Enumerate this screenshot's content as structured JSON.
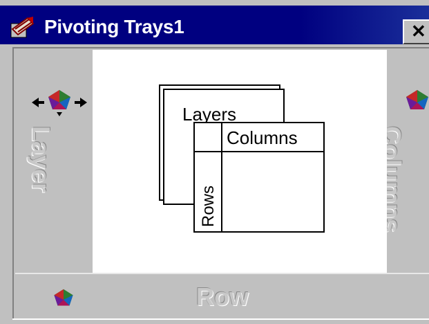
{
  "window": {
    "title": "Pivoting Trays1",
    "close_label": "✕"
  },
  "trays": {
    "layer_label": "Layer",
    "column_label": "Columns",
    "row_label": "Row"
  },
  "diagram": {
    "layers_text": "Layers",
    "columns_text": "Columns",
    "rows_text": "Rows"
  },
  "icons": {
    "app": "pivot-app-icon",
    "layer_pivot": "pivot-move-icon",
    "column_pivot": "pivot-icon",
    "row_pivot": "pivot-icon"
  },
  "colors": {
    "titlebar": "#000080",
    "tray": "#c0c0c0",
    "canvas": "#ffffff"
  }
}
